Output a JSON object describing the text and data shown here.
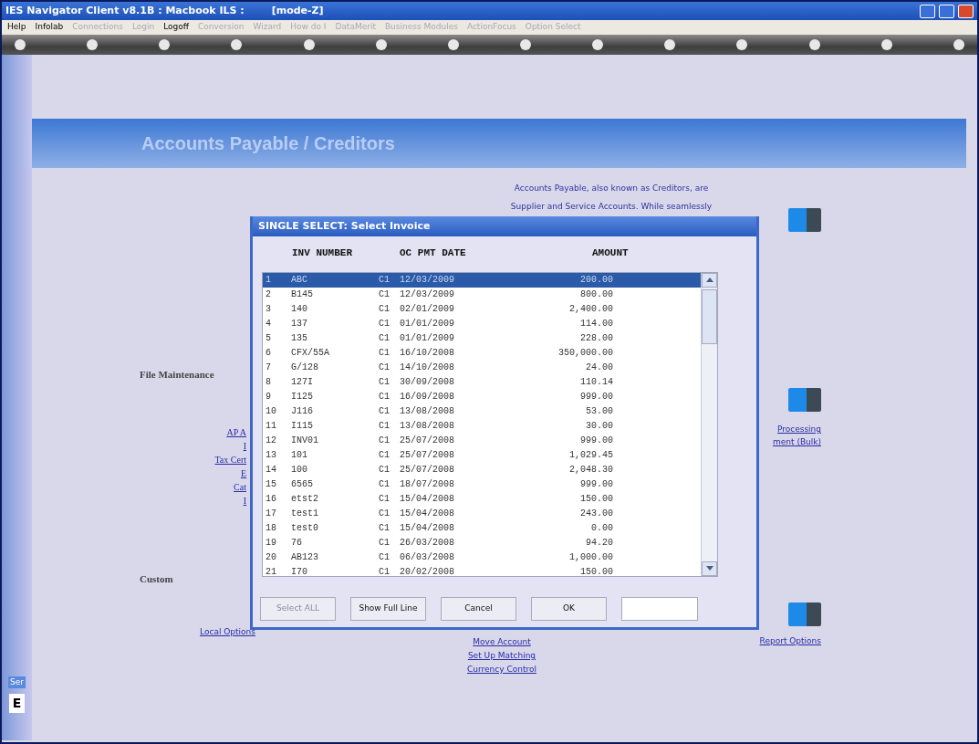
{
  "window": {
    "title": "IES Navigator Client v8.1B : Macbook ILS :",
    "mode": "[mode-Z]"
  },
  "menu": [
    {
      "label": "Help",
      "disabled": false
    },
    {
      "label": "Infolab",
      "disabled": false
    },
    {
      "label": "Connections",
      "disabled": true
    },
    {
      "label": "Login",
      "disabled": true
    },
    {
      "label": "Logoff",
      "disabled": false
    },
    {
      "label": "Conversion",
      "disabled": true
    },
    {
      "label": "Wizard",
      "disabled": true
    },
    {
      "label": "How do I",
      "disabled": true
    },
    {
      "label": "DataMerit",
      "disabled": true
    },
    {
      "label": "Business Modules",
      "disabled": true
    },
    {
      "label": "ActionFocus",
      "disabled": true
    },
    {
      "label": "Option Select",
      "disabled": true
    }
  ],
  "page": {
    "title": "Accounts Payable / Creditors",
    "intro": [
      "Accounts Payable, also known as Creditors, are",
      "Supplier and Service Accounts. While seamlessly"
    ],
    "file_maintenance": {
      "heading": "File Maintenance",
      "left_links": [
        "AP A",
        "I",
        "Tax Cert",
        "E",
        "Cat",
        "I"
      ],
      "right_links": [
        "Processing",
        "ment (Bulk)"
      ]
    },
    "custom": {
      "heading": "Custom",
      "links_left": [
        "Local Options"
      ],
      "links_center": [
        "Move Account",
        "Set Up Matching",
        "Currency Control"
      ],
      "links_right": [
        "Report Options"
      ]
    },
    "side_panel": {
      "label": "Ser",
      "key": "E"
    }
  },
  "dialog": {
    "title": "SINGLE SELECT: Select Invoice",
    "columns": [
      "INV NUMBER",
      "OC PMT DATE",
      "AMOUNT"
    ],
    "rows": [
      {
        "no": "1",
        "number": "ABC",
        "code": "C1",
        "date": "12/03/2009",
        "amount": "200.00",
        "selected": true
      },
      {
        "no": "2",
        "number": "B145",
        "code": "C1",
        "date": "12/03/2009",
        "amount": "800.00",
        "selected": false
      },
      {
        "no": "3",
        "number": "140",
        "code": "C1",
        "date": "02/01/2009",
        "amount": "2,400.00",
        "selected": false
      },
      {
        "no": "4",
        "number": "137",
        "code": "C1",
        "date": "01/01/2009",
        "amount": "114.00",
        "selected": false
      },
      {
        "no": "5",
        "number": "135",
        "code": "C1",
        "date": "01/01/2009",
        "amount": "228.00",
        "selected": false
      },
      {
        "no": "6",
        "number": "CFX/55A",
        "code": "C1",
        "date": "16/10/2008",
        "amount": "350,000.00",
        "selected": false
      },
      {
        "no": "7",
        "number": "G/128",
        "code": "C1",
        "date": "14/10/2008",
        "amount": "24.00",
        "selected": false
      },
      {
        "no": "8",
        "number": "127I",
        "code": "C1",
        "date": "30/09/2008",
        "amount": "110.14",
        "selected": false
      },
      {
        "no": "9",
        "number": "I125",
        "code": "C1",
        "date": "16/09/2008",
        "amount": "999.00",
        "selected": false
      },
      {
        "no": "10",
        "number": "J116",
        "code": "C1",
        "date": "13/08/2008",
        "amount": "53.00",
        "selected": false
      },
      {
        "no": "11",
        "number": "I115",
        "code": "C1",
        "date": "13/08/2008",
        "amount": "30.00",
        "selected": false
      },
      {
        "no": "12",
        "number": "INV01",
        "code": "C1",
        "date": "25/07/2008",
        "amount": "999.00",
        "selected": false
      },
      {
        "no": "13",
        "number": "101",
        "code": "C1",
        "date": "25/07/2008",
        "amount": "1,029.45",
        "selected": false
      },
      {
        "no": "14",
        "number": "100",
        "code": "C1",
        "date": "25/07/2008",
        "amount": "2,048.30",
        "selected": false
      },
      {
        "no": "15",
        "number": "6565",
        "code": "C1",
        "date": "18/07/2008",
        "amount": "999.00",
        "selected": false
      },
      {
        "no": "16",
        "number": "etst2",
        "code": "C1",
        "date": "15/04/2008",
        "amount": "150.00",
        "selected": false
      },
      {
        "no": "17",
        "number": "test1",
        "code": "C1",
        "date": "15/04/2008",
        "amount": "243.00",
        "selected": false
      },
      {
        "no": "18",
        "number": "test0",
        "code": "C1",
        "date": "15/04/2008",
        "amount": "0.00",
        "selected": false
      },
      {
        "no": "19",
        "number": "76",
        "code": "C1",
        "date": "26/03/2008",
        "amount": "94.20",
        "selected": false
      },
      {
        "no": "20",
        "number": "AB123",
        "code": "C1",
        "date": "06/03/2008",
        "amount": "1,000.00",
        "selected": false
      },
      {
        "no": "21",
        "number": "I70",
        "code": "C1",
        "date": "20/02/2008",
        "amount": "150.00",
        "selected": false
      }
    ],
    "buttons": [
      {
        "label": "Select ALL",
        "disabled": true
      },
      {
        "label": "Show Full Line",
        "disabled": false
      },
      {
        "label": "Cancel",
        "disabled": false
      },
      {
        "label": "OK",
        "disabled": false
      }
    ]
  }
}
